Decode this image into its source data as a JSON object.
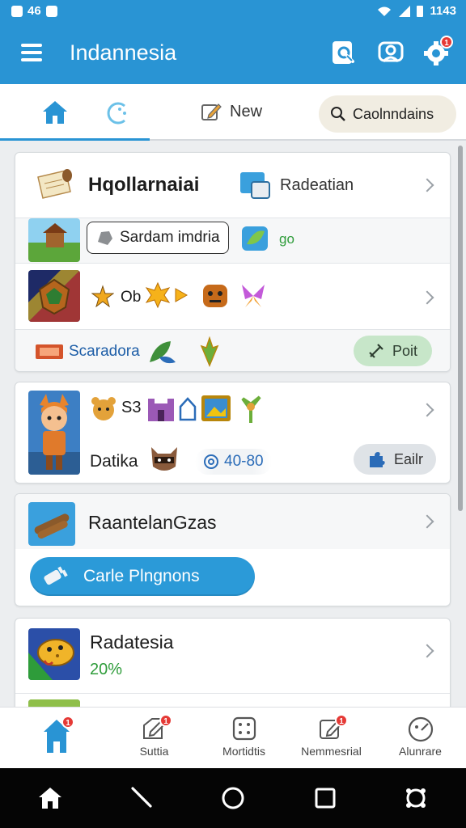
{
  "status_bar": {
    "left_text": "46",
    "right_text": "1143"
  },
  "app_bar": {
    "title": "Indannesia",
    "badge_count": "1"
  },
  "tabs": {
    "new_label": "New",
    "search_label": "Caolnndains"
  },
  "cards": [
    {
      "header_title": "Hqollarnaiai",
      "header_right_label": "Radeatian",
      "chip_label": "Sardam imdria",
      "chip_tag": "go",
      "icon_row_text": "Ob",
      "footer_link": "Scaradora",
      "action_button": "Poit"
    },
    {
      "subtitle": "Datika",
      "counter_text": "40-80",
      "action_button": "Eailr"
    },
    {
      "title": "RaantelanGzas",
      "button_label": "Carle Plngnons"
    },
    {
      "title": "Radatesia",
      "progress_text": "20%"
    }
  ],
  "bottom_nav": [
    {
      "label": "",
      "icon": "home-icon",
      "badge": "1"
    },
    {
      "label": "Suttia",
      "icon": "edit-box-icon",
      "badge": "1"
    },
    {
      "label": "Mortidtis",
      "icon": "dice-icon",
      "badge": ""
    },
    {
      "label": "Nemmesrial",
      "icon": "pencil-icon",
      "badge": "1"
    },
    {
      "label": "Alunrare",
      "icon": "face-icon",
      "badge": ""
    }
  ],
  "colors": {
    "primary": "#2994d4",
    "accent_green": "#2e9c3a",
    "badge_red": "#e53935"
  }
}
